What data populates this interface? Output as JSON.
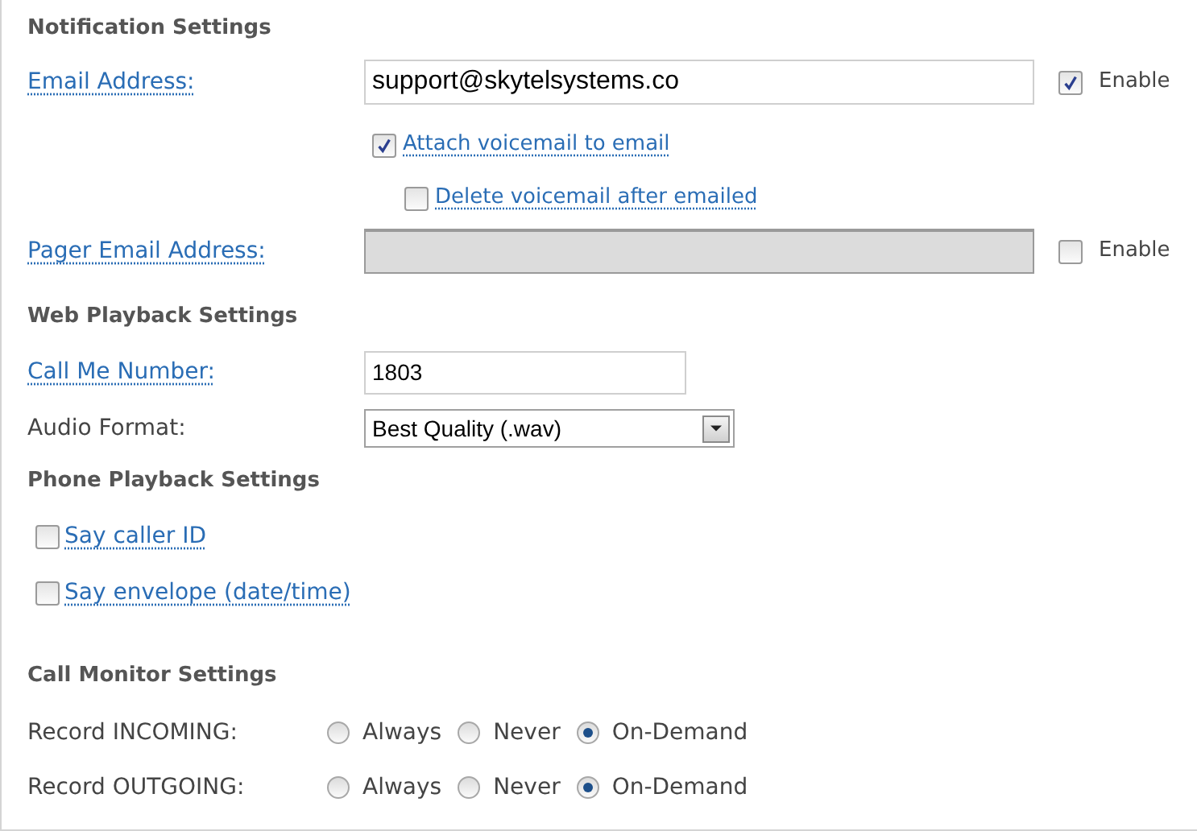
{
  "notification": {
    "heading": "Notification Settings",
    "email": {
      "label": "Email Address:",
      "value": "support@skytelsystems.co",
      "enable_label": "Enable",
      "enabled": true
    },
    "attach": {
      "label": "Attach voicemail to email",
      "checked": true
    },
    "delete": {
      "label": "Delete voicemail after emailed",
      "checked": false
    },
    "pager": {
      "label": "Pager Email Address:",
      "disabled": true,
      "enable_label": "Enable",
      "enabled": false
    }
  },
  "web_playback": {
    "heading": "Web Playback Settings",
    "call_me": {
      "label": "Call Me Number:",
      "value": "1803"
    },
    "audio_format": {
      "label": "Audio Format:",
      "value": "Best Quality (.wav)"
    }
  },
  "phone_playback": {
    "heading": "Phone Playback Settings",
    "options": [
      {
        "label": "Say caller ID",
        "checked": false
      },
      {
        "label": "Say envelope (date/time)",
        "checked": false
      }
    ]
  },
  "call_monitor": {
    "heading": "Call Monitor Settings",
    "rows": [
      {
        "label": "Record INCOMING:",
        "options": [
          {
            "label": "Always",
            "selected": false
          },
          {
            "label": "Never",
            "selected": false
          },
          {
            "label": "On-Demand",
            "selected": true
          }
        ]
      },
      {
        "label": "Record OUTGOING:",
        "options": [
          {
            "label": "Always",
            "selected": false
          },
          {
            "label": "Never",
            "selected": false
          },
          {
            "label": "On-Demand",
            "selected": true
          }
        ]
      }
    ]
  }
}
